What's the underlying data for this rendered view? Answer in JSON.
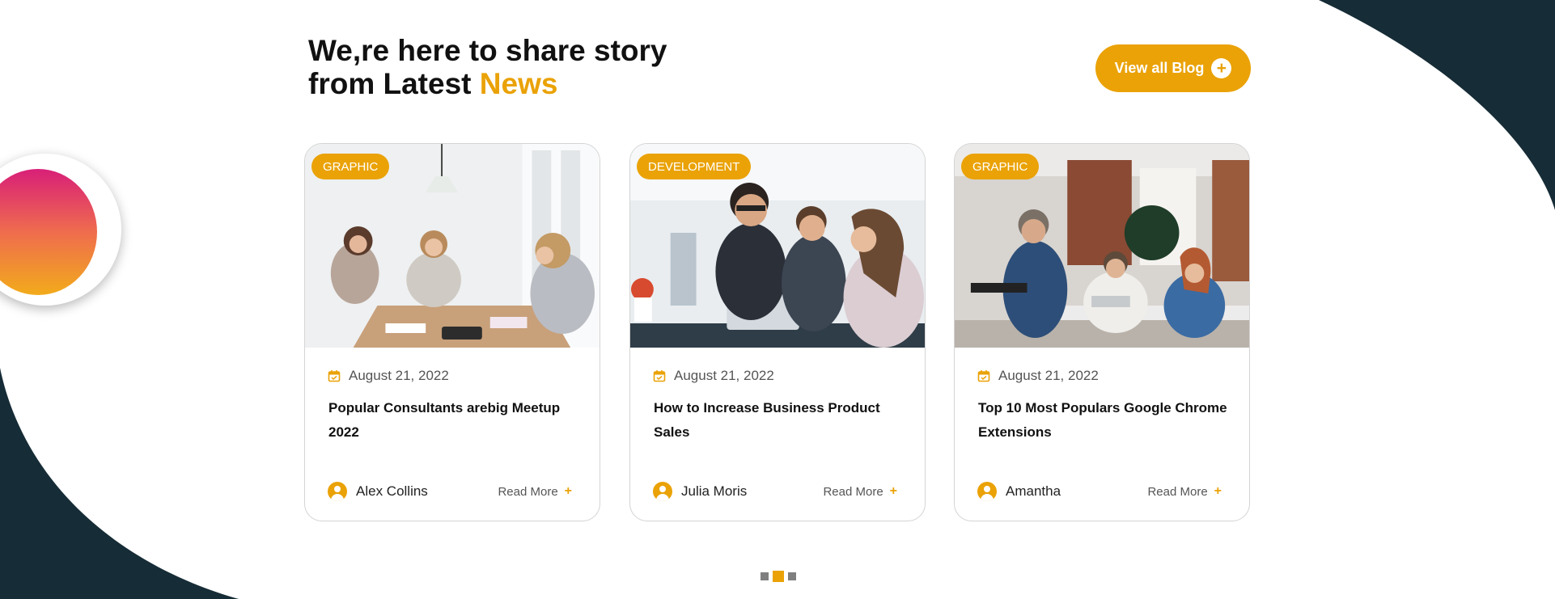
{
  "heading": {
    "line1": "We,re here to share story",
    "line2_prefix": "from Latest ",
    "line2_accent": "News"
  },
  "view_all_button": {
    "label": "View all Blog",
    "icon": "plus-circle-icon"
  },
  "colors": {
    "accent": "#eaa207",
    "dark": "#162c36",
    "gradient_top": "#d81f78",
    "gradient_bottom": "#f2ab1b"
  },
  "cards": [
    {
      "category": "GRAPHIC",
      "date": "August 21, 2022",
      "title": "Popular Consultants arebig Meetup 2022",
      "author": "Alex Collins",
      "read_more": "Read More"
    },
    {
      "category": "DEVELOPMENT",
      "date": "August 21, 2022",
      "title": "How to Increase Business Product Sales",
      "author": "Julia Moris",
      "read_more": "Read More"
    },
    {
      "category": "GRAPHIC",
      "date": "August 21, 2022",
      "title": "Top 10 Most Populars Google Chrome Extensions",
      "author": "Amantha",
      "read_more": "Read More"
    }
  ],
  "pager": {
    "total_pages": 3,
    "active_page": 2
  }
}
